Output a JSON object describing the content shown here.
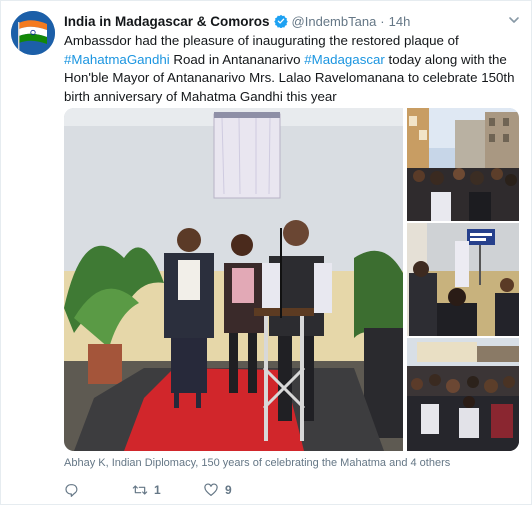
{
  "account": {
    "display_name": "India in Madagascar & Comoros",
    "handle": "@IndembTana",
    "separator": "·",
    "time": "14h",
    "verified_color": "#1da1f2"
  },
  "tweet": {
    "segments": [
      {
        "text": "Ambassdor had the pleasure of inaugurating the restored plaque of ",
        "hashtag": false
      },
      {
        "text": "#MahatmaGandhi",
        "hashtag": true
      },
      {
        "text": " Road in Antananarivo ",
        "hashtag": false
      },
      {
        "text": "#Madagascar",
        "hashtag": true
      },
      {
        "text": " today along with the Hon'ble Mayor of Antananarivo Mrs. Lalao Ravelomanana to celebrate 150th birth anniversary of Mahatma Gandhi this year",
        "hashtag": false
      }
    ]
  },
  "media": {
    "photos": [
      "plaque-unveiling-main",
      "street-crowd",
      "plaque-closeup",
      "gathering-crowd"
    ],
    "caption": "Abhay K, Indian Diplomacy, 150 years of celebrating the Mahatma and 4 others"
  },
  "actions": {
    "reply_count": "",
    "retweet_count": "1",
    "like_count": "9"
  },
  "colors": {
    "link": "#1b95e0",
    "muted": "#657786",
    "text": "#14171a"
  }
}
